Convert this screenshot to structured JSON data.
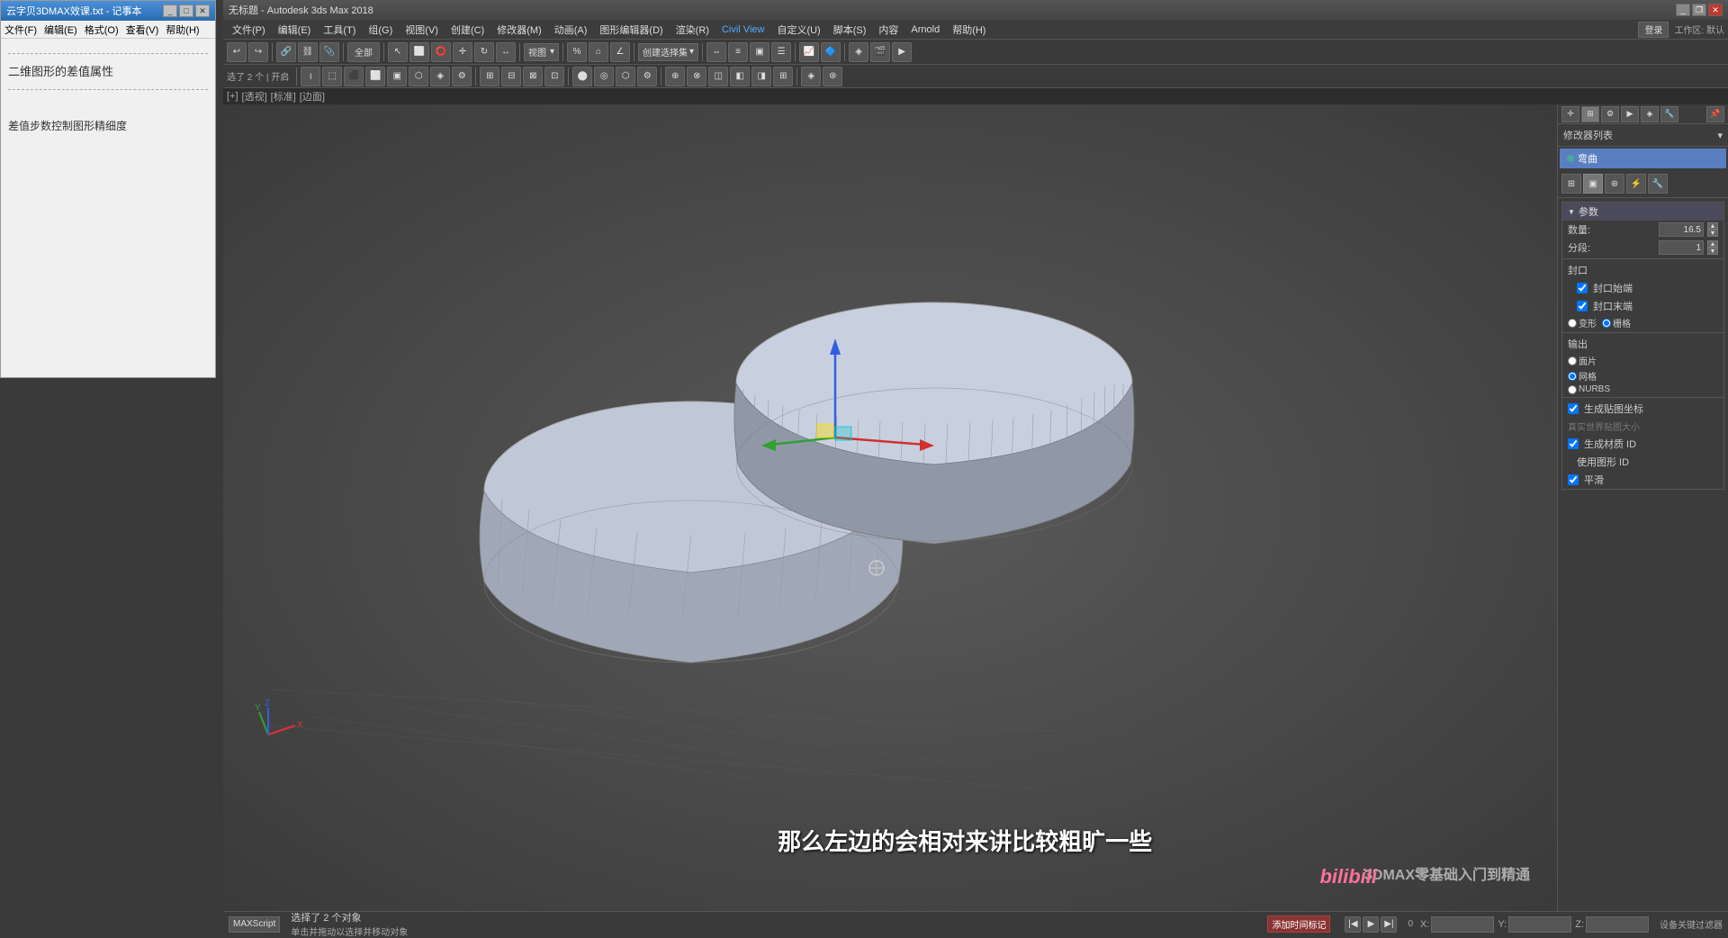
{
  "notepad": {
    "title": "云字贝3DMAX效课.txt - 记事本",
    "menu": [
      "文件(F)",
      "编辑(E)",
      "格式(O)",
      "查看(V)",
      "帮助(H)"
    ],
    "content": [
      "------------------------",
      "二维图形的差值属性",
      "------------------------",
      "差值步数控制图形精细度"
    ]
  },
  "max": {
    "title": "无标题 - Autodesk 3ds Max 2018",
    "menu": [
      "文件(P)",
      "编辑(E)",
      "工具(T)",
      "组(G)",
      "视图(V)",
      "创建(C)",
      "修改器(M)",
      "动画(A)",
      "图形编辑器(D)",
      "渲染(R)",
      "Civil View",
      "自定义(U)",
      "脚本(S)",
      "内容",
      "Arnold",
      "帮助(H)"
    ],
    "civil_view": "Civil View",
    "viewport_label": [
      "[+]",
      "[透视]",
      "[标准]",
      "[边面]"
    ],
    "status": {
      "selected": "选择了 2 个对象",
      "hint": "单击并拖动以选择并移动对象",
      "time_label": "0",
      "coord_x_label": "X:",
      "coord_y_label": "Y:",
      "coord_z_label": "Z:",
      "animation_label": "添加时间标记"
    },
    "subtitle": "那么左边的会相对来讲比较粗旷一些",
    "watermark": "3DMAX零基础入门到精通",
    "bili": "bilibili",
    "right_panel": {
      "modifier_list_label": "修改器列表",
      "modifier_item": "弯曲",
      "params_label": "参数",
      "count_label": "数量:",
      "count_value": "16.5",
      "segments_label": "分段:",
      "segments_value": "1",
      "cap_label": "封口",
      "cap_start_label": "封口始端",
      "cap_end_label": "封口末端",
      "morph_label": "变形",
      "grid_label": "栅格",
      "output_label": "输出",
      "surface_label": "面片",
      "mesh_label": "网格",
      "nurbs_label": "NURBS",
      "gen_map_label": "生成贴图坐标",
      "real_world_label": "真实世界贴图大小",
      "gen_mat_id_label": "生成材质 ID",
      "use_shape_id_label": "使用图形 ID",
      "smooth_label": "平滑"
    }
  }
}
